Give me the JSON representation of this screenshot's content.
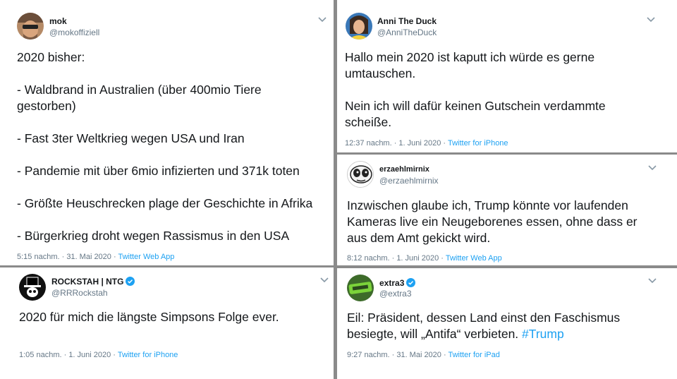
{
  "tweets": [
    {
      "name": "mok",
      "handle": "@mokoffiziell",
      "lines": [
        "2020 bisher:",
        "",
        "- Waldbrand in Australien (über 400mio Tiere",
        "gestorben)",
        "",
        "- Fast 3ter Weltkrieg wegen USA und Iran",
        "",
        "- Pandemie mit über 6mio infizierten und 371k toten",
        "",
        "- Größte Heuschrecken plage der Geschichte in Afrika",
        "",
        "- Bürgerkrieg droht wegen Rassismus in den USA"
      ],
      "time": "5:15 nachm. · 31. Mai 2020 · ",
      "source": "Twitter Web App",
      "avatar": "person-with-glasses-avatar"
    },
    {
      "name": "Anni The Duck",
      "handle": "@AnniTheDuck",
      "lines": [
        "Hallo mein 2020 ist kaputt ich würde es gerne",
        "umtauschen.",
        "",
        "Nein ich will dafür keinen Gutschein verdammte",
        "scheiße."
      ],
      "time": "12:37 nachm. · 1. Juni 2020 · ",
      "source": "Twitter for iPhone",
      "avatar": "woman-avatar"
    },
    {
      "name": "erzaehlmirnix",
      "handle": "@erzaehlmirnix",
      "lines": [
        "Inzwischen glaube ich, Trump könnte vor laufenden",
        "Kameras live ein Neugeborenes essen, ohne dass er",
        "aus dem Amt gekickt wird."
      ],
      "time": "8:12 nachm. · 1. Juni 2020 · ",
      "source": "Twitter Web App",
      "avatar": "cartoon-face-avatar"
    },
    {
      "name": "ROCKSTAH | NTG",
      "handle": "@RRRockstah",
      "lines": [
        "2020 für mich die längste Simpsons Folge ever."
      ],
      "time": "1:05 nachm. · 1. Juni 2020 · ",
      "source": "Twitter for iPhone",
      "avatar": "top-hat-skull-avatar",
      "verified": true
    },
    {
      "name": "extra3",
      "handle": "@extra3",
      "lines": [
        "Eil: Präsident, dessen Land einst den Faschismus",
        "besiegte, will „Antifa“ verbieten. "
      ],
      "hashtag": "#Trump",
      "time": "9:27 nachm. · 31. Mai 2020 · ",
      "source": "Twitter for iPad",
      "avatar": "extra3-logo-avatar",
      "verified": true
    }
  ],
  "colors": {
    "link": "#1da1f2",
    "muted": "#657786",
    "text": "#14171a",
    "divider": "#8a8a8a"
  }
}
